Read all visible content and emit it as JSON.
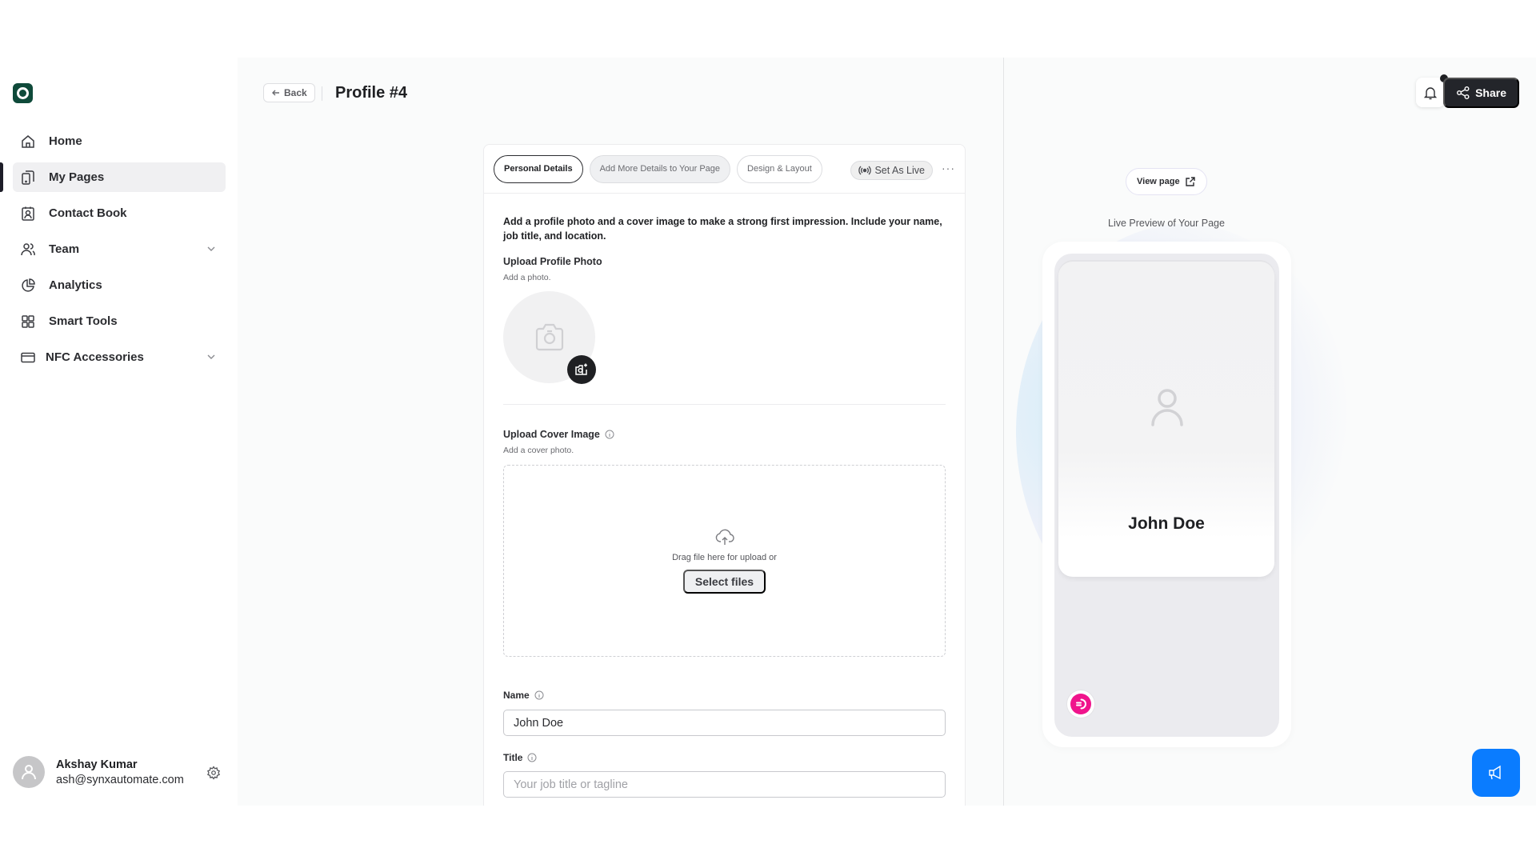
{
  "sidebar": {
    "logo": "brand-logo",
    "items": [
      {
        "label": "Home",
        "icon": "home-icon",
        "active": false,
        "expandable": false
      },
      {
        "label": "My Pages",
        "icon": "pages-icon",
        "active": true,
        "expandable": false
      },
      {
        "label": "Contact Book",
        "icon": "contact-book-icon",
        "active": false,
        "expandable": false
      },
      {
        "label": "Team",
        "icon": "team-icon",
        "active": false,
        "expandable": true
      },
      {
        "label": "Analytics",
        "icon": "pie-chart-icon",
        "active": false,
        "expandable": false
      },
      {
        "label": "Smart Tools",
        "icon": "grid-icon",
        "active": false,
        "expandable": false
      },
      {
        "label": "NFC Accessories",
        "icon": "card-icon",
        "active": false,
        "expandable": true
      }
    ],
    "user": {
      "name": "Akshay Kumar",
      "email": "ash@synxautomate.com"
    }
  },
  "header": {
    "back_label": "Back",
    "title": "Profile #4"
  },
  "editor": {
    "tabs": [
      {
        "label": "Personal Details",
        "state": "active"
      },
      {
        "label": "Add More Details to Your Page",
        "state": "muted"
      },
      {
        "label": "Design & Layout",
        "state": "default"
      }
    ],
    "set_live_label": "Set As Live",
    "more_label": "···",
    "intro": "Add a profile photo and a cover image to make a strong first impression. Include your name, job title, and location.",
    "profile_photo": {
      "label": "Upload Profile Photo",
      "hint": "Add a photo."
    },
    "cover_image": {
      "label": "Upload Cover Image",
      "hint": "Add a cover photo.",
      "drop_text": "Drag file here for upload or",
      "select_label": "Select files"
    },
    "fields": {
      "name": {
        "label": "Name",
        "value": "John Doe",
        "placeholder": ""
      },
      "title": {
        "label": "Title",
        "value": "",
        "placeholder": "Your job title or tagline"
      }
    }
  },
  "toolbar": {
    "share_label": "Share",
    "notification_dot": true
  },
  "preview": {
    "view_page_label": "View page",
    "caption": "Live Preview of Your Page",
    "card_name": "John Doe"
  },
  "colors": {
    "accent_dark": "#23252a",
    "brand_pink": "#f0148c",
    "announce_blue": "#0a7cff"
  }
}
